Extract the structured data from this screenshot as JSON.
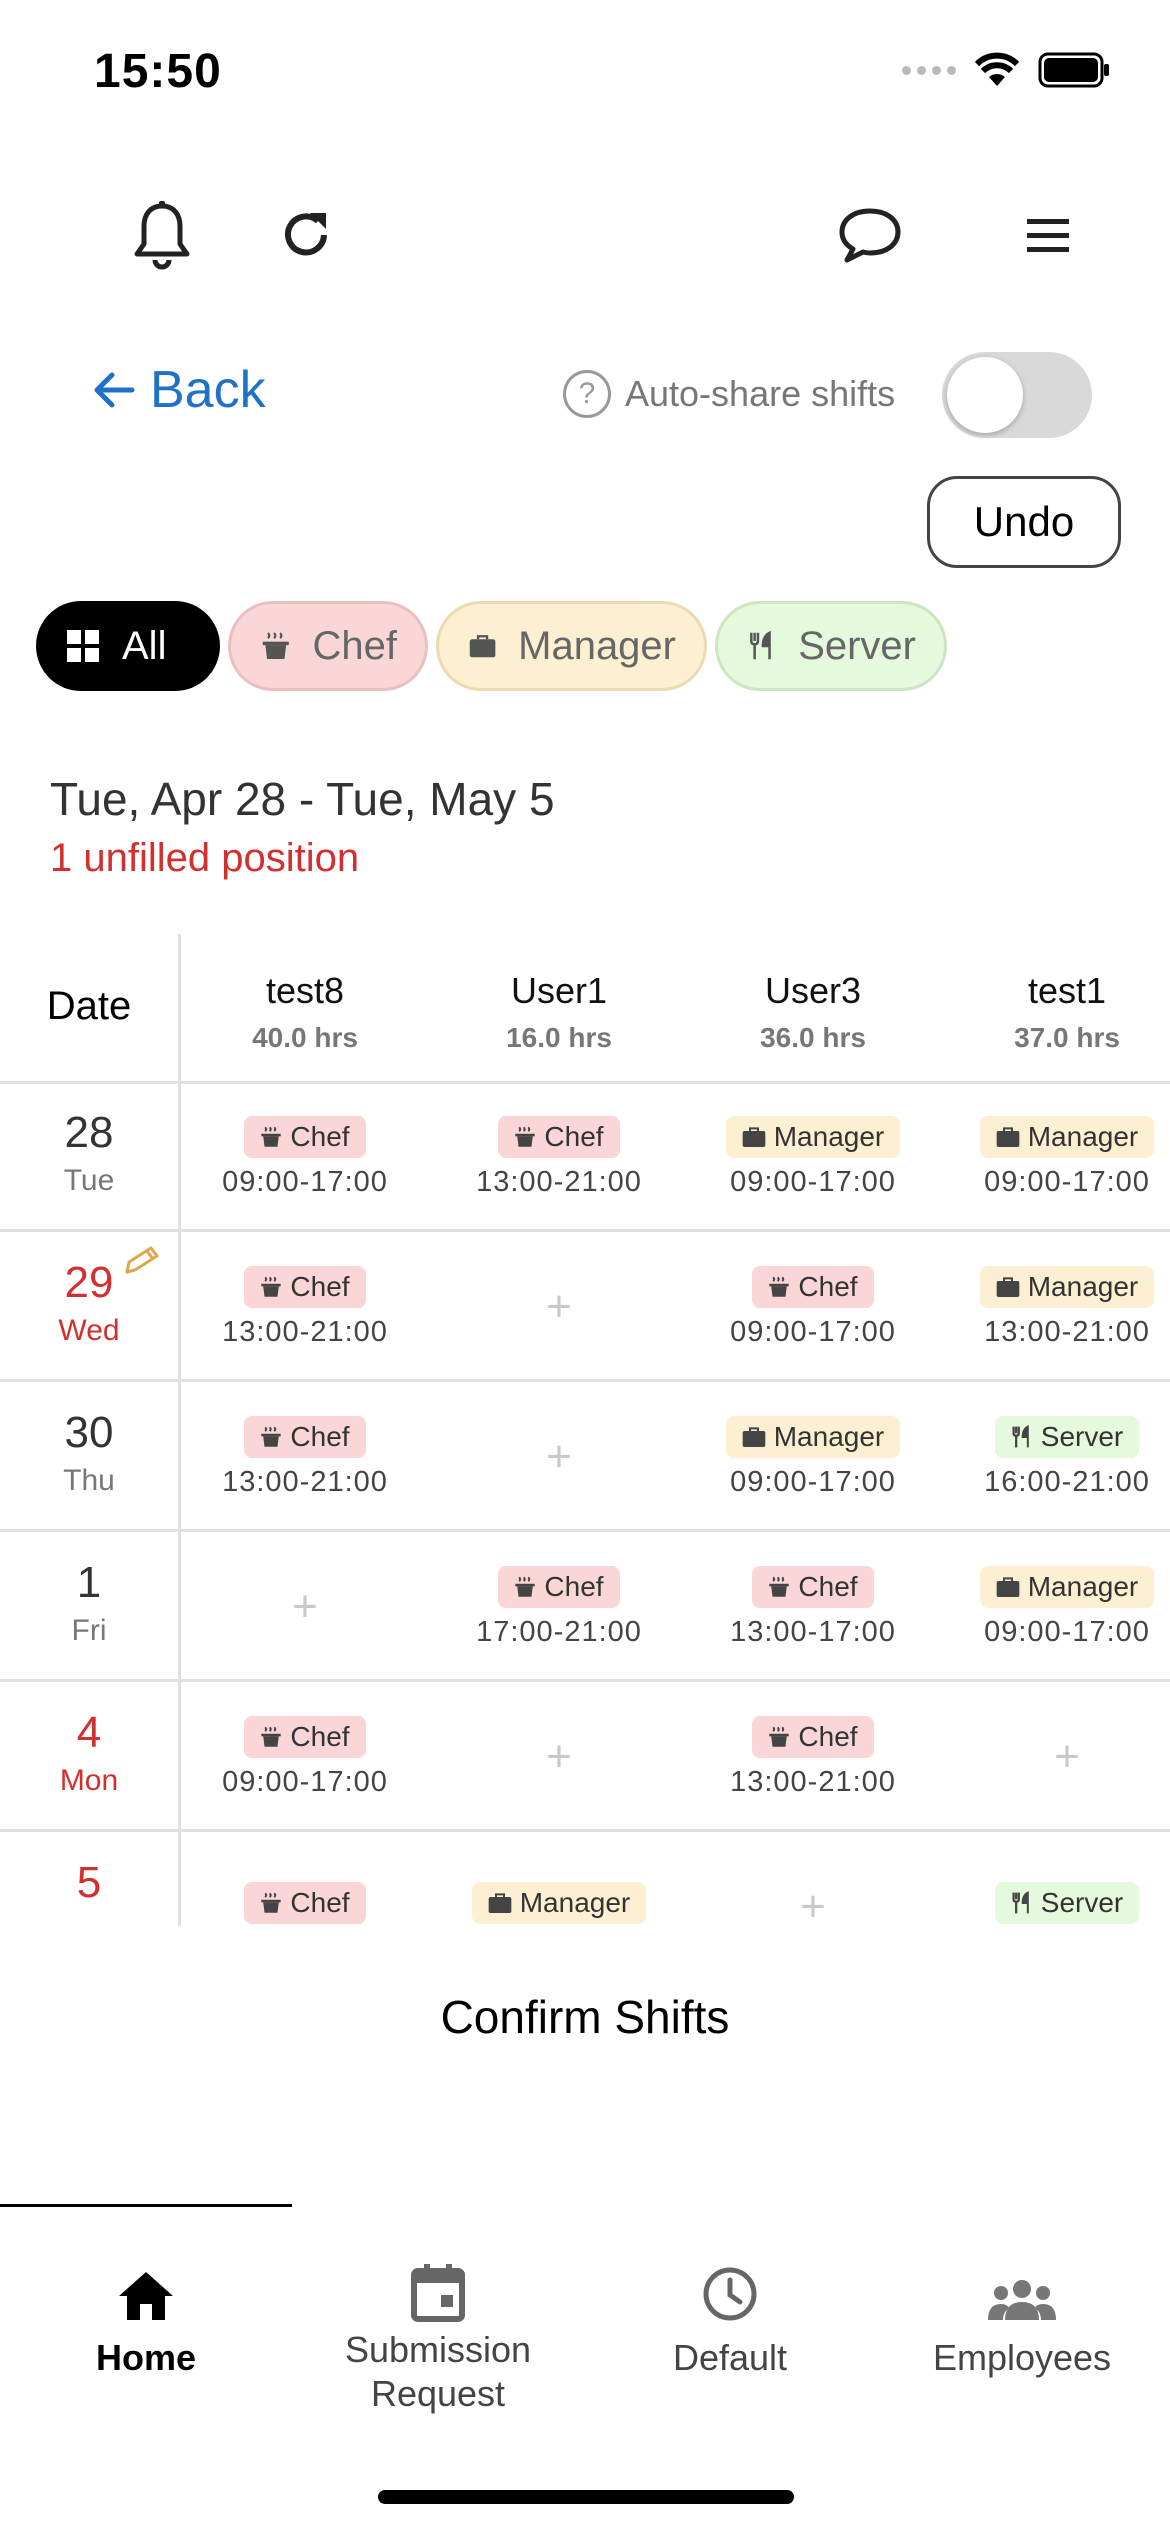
{
  "status": {
    "time": "15:50"
  },
  "nav": {
    "back_label": "Back",
    "autoshare_label": "Auto-share shifts",
    "autoshare_on": false,
    "undo_label": "Undo"
  },
  "filters": [
    {
      "label": "All",
      "icon": "grid-icon"
    },
    {
      "label": "Chef",
      "icon": "pot-icon"
    },
    {
      "label": "Manager",
      "icon": "briefcase-icon"
    },
    {
      "label": "Server",
      "icon": "utensils-icon"
    }
  ],
  "range": {
    "title": "Tue, Apr 28 - Tue, May 5",
    "unfilled": "1 unfilled position"
  },
  "grid": {
    "date_header": "Date",
    "employees": [
      {
        "name": "test8",
        "hours": "40.0 hrs"
      },
      {
        "name": "User1",
        "hours": "16.0 hrs"
      },
      {
        "name": "User3",
        "hours": "36.0 hrs"
      },
      {
        "name": "test1",
        "hours": "37.0 hrs"
      }
    ],
    "rows": [
      {
        "day": "28",
        "weekday": "Tue",
        "highlight": false,
        "edited": false,
        "shifts": [
          {
            "role": "Chef",
            "time": "09:00-17:00"
          },
          {
            "role": "Chef",
            "time": "13:00-21:00"
          },
          {
            "role": "Manager",
            "time": "09:00-17:00"
          },
          {
            "role": "Manager",
            "time": "09:00-17:00"
          }
        ]
      },
      {
        "day": "29",
        "weekday": "Wed",
        "highlight": true,
        "edited": true,
        "shifts": [
          {
            "role": "Chef",
            "time": "13:00-21:00"
          },
          null,
          {
            "role": "Chef",
            "time": "09:00-17:00"
          },
          {
            "role": "Manager",
            "time": "13:00-21:00"
          }
        ]
      },
      {
        "day": "30",
        "weekday": "Thu",
        "highlight": false,
        "edited": false,
        "shifts": [
          {
            "role": "Chef",
            "time": "13:00-21:00"
          },
          null,
          {
            "role": "Manager",
            "time": "09:00-17:00"
          },
          {
            "role": "Server",
            "time": "16:00-21:00"
          }
        ]
      },
      {
        "day": "1",
        "weekday": "Fri",
        "highlight": false,
        "edited": false,
        "shifts": [
          null,
          {
            "role": "Chef",
            "time": "17:00-21:00"
          },
          {
            "role": "Chef",
            "time": "13:00-17:00"
          },
          {
            "role": "Manager",
            "time": "09:00-17:00"
          }
        ]
      },
      {
        "day": "4",
        "weekday": "Mon",
        "highlight": true,
        "edited": false,
        "shifts": [
          {
            "role": "Chef",
            "time": "09:00-17:00"
          },
          null,
          {
            "role": "Chef",
            "time": "13:00-21:00"
          },
          null
        ]
      },
      {
        "day": "5",
        "weekday": "",
        "highlight": true,
        "edited": false,
        "shifts": [
          {
            "role": "Chef",
            "time": ""
          },
          {
            "role": "Manager",
            "time": ""
          },
          null,
          {
            "role": "Server",
            "time": ""
          }
        ]
      }
    ]
  },
  "confirm_label": "Confirm Shifts",
  "bottom_nav": [
    {
      "label": "Home",
      "icon": "home-icon",
      "active": true
    },
    {
      "label": "Submission\nRequest",
      "icon": "calendar-icon",
      "active": false
    },
    {
      "label": "Default",
      "icon": "clock-icon",
      "active": false
    },
    {
      "label": "Employees",
      "icon": "people-icon",
      "active": false
    }
  ],
  "colors": {
    "accent": "#1f72c8",
    "alert": "#d32f2f",
    "chef": "#fbd6d6",
    "manager": "#fdf0d2",
    "server": "#e5f9dc"
  }
}
